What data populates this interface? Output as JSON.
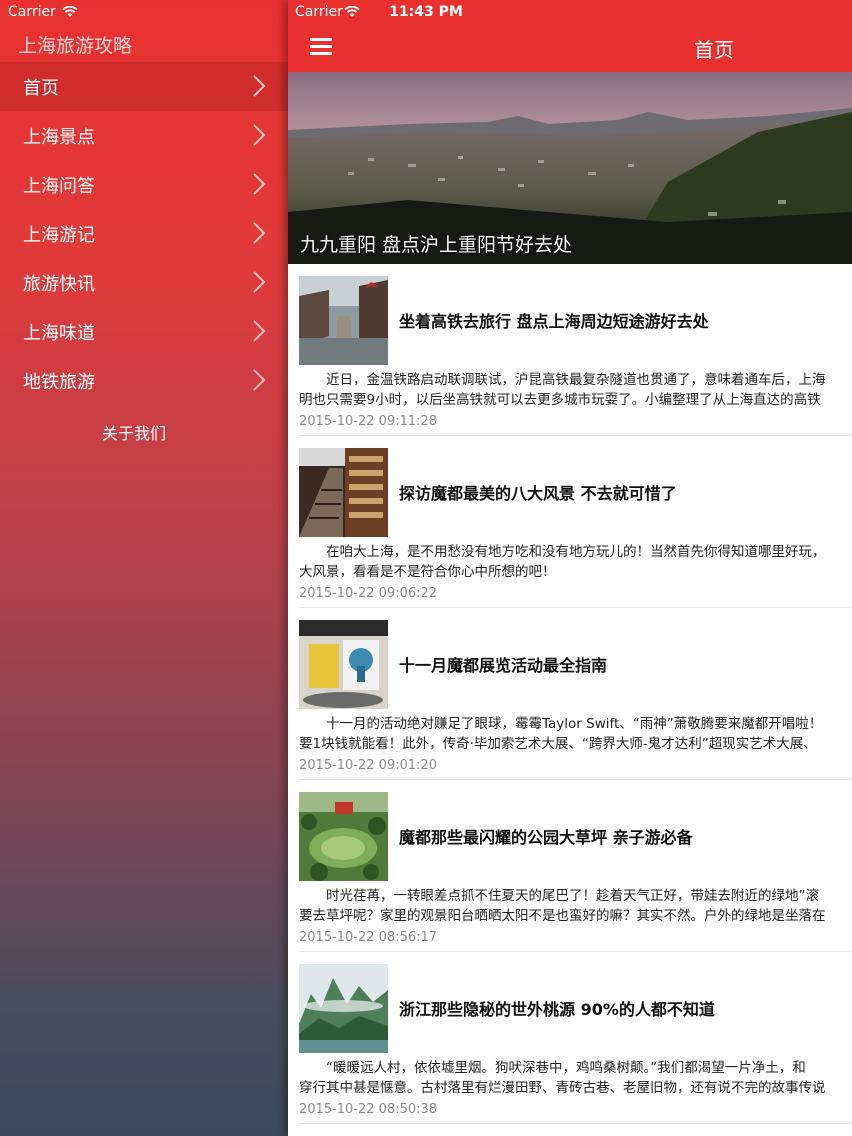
{
  "status_bar": {
    "carrier": "Carrier",
    "time": "11:43 PM"
  },
  "sidebar": {
    "title": "上海旅游攻略",
    "items": [
      {
        "label": "首页"
      },
      {
        "label": "上海景点"
      },
      {
        "label": "上海问答"
      },
      {
        "label": "上海游记"
      },
      {
        "label": "旅游快讯"
      },
      {
        "label": "上海味道"
      },
      {
        "label": "地铁旅游"
      }
    ],
    "about": "关于我们"
  },
  "navbar": {
    "title": "首页",
    "menu_icon": "hamburger-icon"
  },
  "banner": {
    "caption": "九九重阳 盘点沪上重阳节好去处"
  },
  "articles": [
    {
      "title": "坐着高铁去旅行 盘点上海周边短途游好去处",
      "summary_line1": "　　近日，金温铁路启动联调联试，沪昆高铁最复杂隧道也贯通了，意味着通车后，上海",
      "summary_line2": "明也只需要9小时，以后坐高铁就可以去更多城市玩耍了。小编整理了从上海直达的高铁",
      "date": "2015-10-22 09:11:28"
    },
    {
      "title": "探访魔都最美的八大风景 不去就可惜了",
      "summary_line1": "　　在咱大上海，是不用愁没有地方吃和没有地方玩儿的！当然首先你得知道哪里好玩，",
      "summary_line2": "大风景，看看是不是符合你心中所想的吧！",
      "date": "2015-10-22 09:06:22"
    },
    {
      "title": "十一月魔都展览活动最全指南",
      "summary_line1": "　　十一月的活动绝对赚足了眼球，霉霉Taylor Swift、“雨神”萧敬腾要来魔都开唱啦！",
      "summary_line2": "要1块钱就能看！此外，传奇·毕加索艺术大展、“跨界大师-鬼才达利”超现实艺术大展、",
      "date": "2015-10-22 09:01:20"
    },
    {
      "title": "魔都那些最闪耀的公园大草坪 亲子游必备",
      "summary_line1": "　　时光荏苒，一转眼差点抓不住夏天的尾巴了！趁着天气正好，带娃去附近的绿地”滚",
      "summary_line2": "要去草坪呢？家里的观景阳台晒晒太阳不是也蛮好的嘛？其实不然。户外的绿地是坐落在",
      "date": "2015-10-22 08:56:17"
    },
    {
      "title": "浙江那些隐秘的世外桃源 90%的人都不知道",
      "summary_line1": "　　“暖暖远人村，依依墟里烟。狗吠深巷中，鸡鸣桑树颠。”我们都渴望一片净土，和",
      "summary_line2": "穿行其中甚是惬意。古村落里有烂漫田野、青砖古巷、老屋旧物，还有说不完的故事传说",
      "date": "2015-10-22 08:50:38"
    }
  ]
}
